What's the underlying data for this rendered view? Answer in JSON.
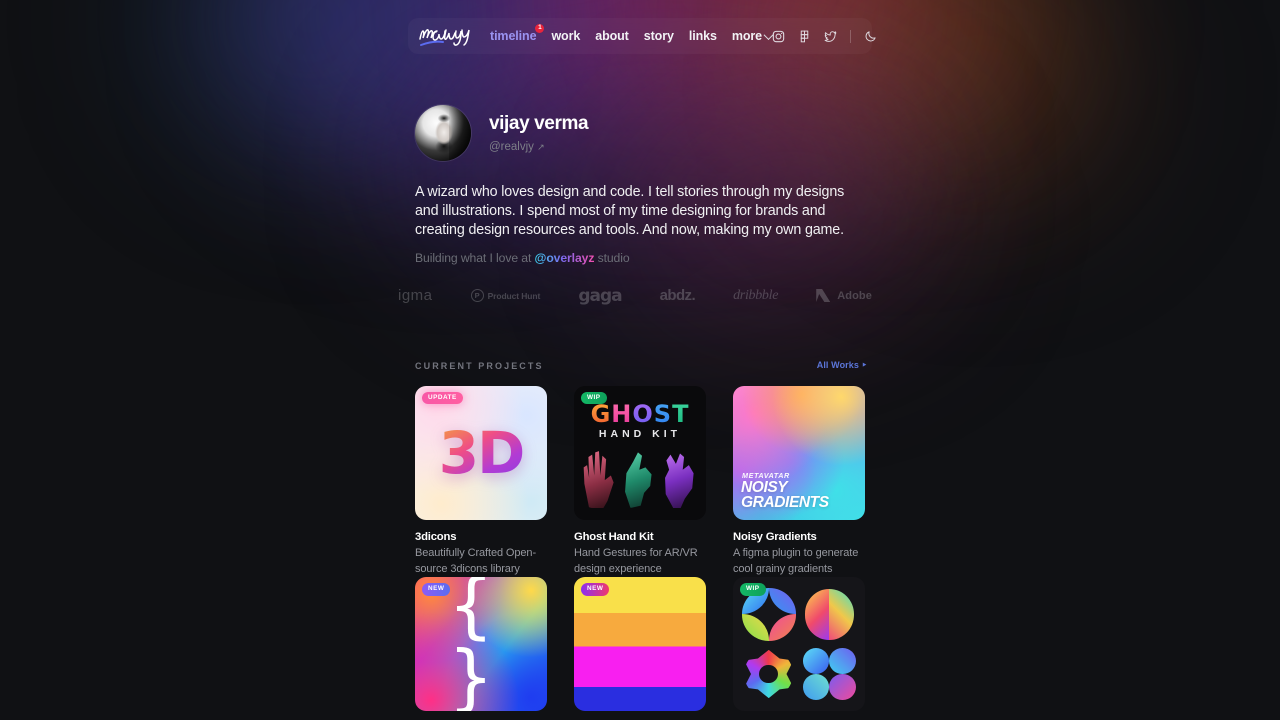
{
  "nav": {
    "logo_text": "realvjy",
    "links": [
      {
        "label": "timeline",
        "active": true,
        "badge": "1"
      },
      {
        "label": "work",
        "active": false
      },
      {
        "label": "about",
        "active": false
      },
      {
        "label": "story",
        "active": false
      },
      {
        "label": "links",
        "active": false
      },
      {
        "label": "more",
        "active": false,
        "has_chevron": true
      }
    ],
    "social": [
      {
        "name": "instagram-icon"
      },
      {
        "name": "figma-icon"
      },
      {
        "name": "twitter-icon"
      },
      {
        "name": "dark-mode-toggle-icon"
      }
    ]
  },
  "profile": {
    "name": "vijay verma",
    "handle": "@realvjy",
    "handle_arrow": "↗",
    "bio": "A wizard who loves design and code. I tell stories through my designs and illustrations. I spend most of my time designing for brands and creating design resources and tools. And now, making my own game.",
    "building_prefix": "Building what I love at ",
    "building_link": "@overlayz",
    "building_suffix": " studio"
  },
  "brands": [
    {
      "name": "figma",
      "label": "igma"
    },
    {
      "name": "product-hunt",
      "label": "Product Hunt",
      "mark": "P"
    },
    {
      "name": "gaga",
      "label": "gaga"
    },
    {
      "name": "abdz",
      "label": "abdz."
    },
    {
      "name": "dribbble",
      "label": "dribbble"
    },
    {
      "name": "adobe",
      "label": "Adobe"
    }
  ],
  "section": {
    "title": "CURRENT PROJECTS",
    "link": "All Works ‣"
  },
  "projects": [
    {
      "badge": "UPDATE",
      "badge_style": "bg-update",
      "thumb": "t-3dicons",
      "title": "3dicons",
      "desc": "Beautifully Crafted Open-source 3dicons library",
      "art_text": "3D"
    },
    {
      "badge": "WIP",
      "badge_style": "bg-wip",
      "thumb": "t-ghost",
      "title": "Ghost Hand Kit",
      "desc": "Hand Gestures for AR/VR design experience",
      "art_word": "GHOST",
      "art_sub": "HAND KIT"
    },
    {
      "badge": "",
      "badge_style": "",
      "thumb": "t-noisy",
      "title": "Noisy Gradients",
      "desc": "A figma plugin to generate cool grainy gradients",
      "art_label": "METAVATAR",
      "art_title": "NOISY GRADIENTS"
    },
    {
      "badge": "NEW",
      "badge_style": "bg-new-purple",
      "thumb": "t-braces",
      "title": "",
      "desc": "",
      "art_text": "{ }"
    },
    {
      "badge": "NEW",
      "badge_style": "bg-new-pink",
      "thumb": "t-bands",
      "title": "",
      "desc": ""
    },
    {
      "badge": "WIP",
      "badge_style": "bg-wip",
      "thumb": "t-shapes",
      "title": "",
      "desc": ""
    }
  ],
  "colors": {
    "background": "#101114",
    "accent_link": "#5b75d8",
    "nav_active": "#9a93f0",
    "badge_red": "#e8243c",
    "badge_green": "#14b866",
    "badge_pink": "#f857a6"
  }
}
